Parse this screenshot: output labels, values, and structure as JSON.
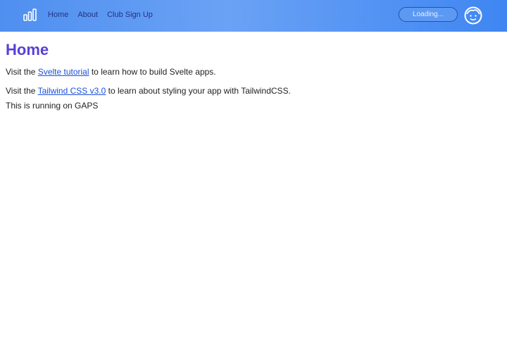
{
  "nav": {
    "logo_icon": "bar-chart-icon",
    "links": [
      "Home",
      "About",
      "Club Sign Up"
    ],
    "loading_label": "Loading...",
    "avatar_icon": "face-avatar-icon"
  },
  "page": {
    "title": "Home",
    "line1": {
      "prefix": "Visit the ",
      "link": "Svelte tutorial",
      "suffix": " to learn how to build Svelte apps."
    },
    "line2": {
      "prefix": "Visit the ",
      "link": "Tailwind CSS v3.0",
      "suffix": " to learn about styling your app with TailwindCSS."
    },
    "line3": "This is running on GAPS"
  },
  "colors": {
    "nav_start": "#4f8ff0",
    "nav_end": "#3f86f2",
    "title": "#5a3fd6",
    "link": "#1b4fd6"
  }
}
